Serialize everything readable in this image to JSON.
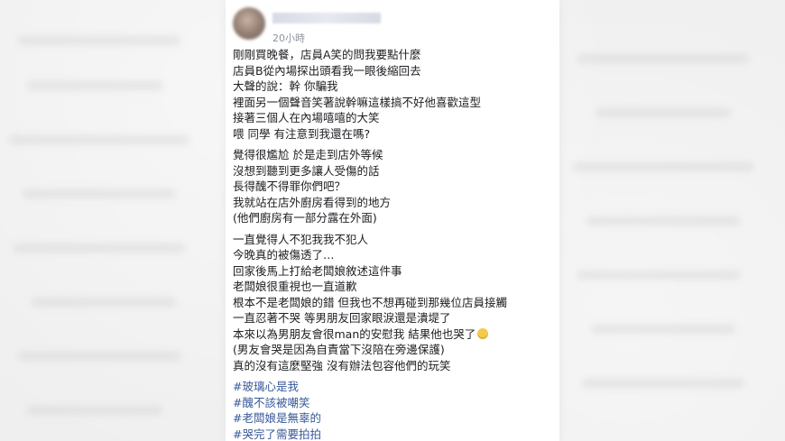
{
  "post": {
    "time": "20小時",
    "paragraphs": [
      [
        "剛剛買晚餐，店員A笑的問我要點什麼",
        "店員B從內場探出頭看我一眼後縮回去",
        "大聲的說：幹 你騙我",
        "裡面另一個聲音笑著說幹嘛這樣搞不好他喜歡這型",
        "接著三個人在內場嘻嘻的大笑",
        "喂 同學 有注意到我還在嗎?"
      ],
      [
        "覺得很尷尬 於是走到店外等候",
        "沒想到聽到更多讓人受傷的話",
        "長得醜不得罪你們吧？",
        "我就站在店外廚房看得到的地方",
        "(他們廚房有一部分露在外面)"
      ],
      [
        "一直覺得人不犯我我不犯人",
        "今晚真的被傷透了…",
        "回家後馬上打給老闆娘敘述這件事",
        "老闆娘很重視也一直道歉",
        "根本不是老闆娘的錯 但我也不想再碰到那幾位店員接觸",
        "一直忍著不哭 等男朋友回家眼淚還是潰堤了",
        "本來以為男朋友會很man的安慰我 結果他也哭了",
        "(男友會哭是因為自責當下沒陪在旁邊保護)",
        "真的沒有這麼堅強 沒有辦法包容他們的玩笑"
      ]
    ],
    "hashtags": [
      "#玻璃心是我",
      "#醜不該被嘲笑",
      "#老闆娘是無辜的",
      "#哭完了需要拍拍"
    ]
  }
}
